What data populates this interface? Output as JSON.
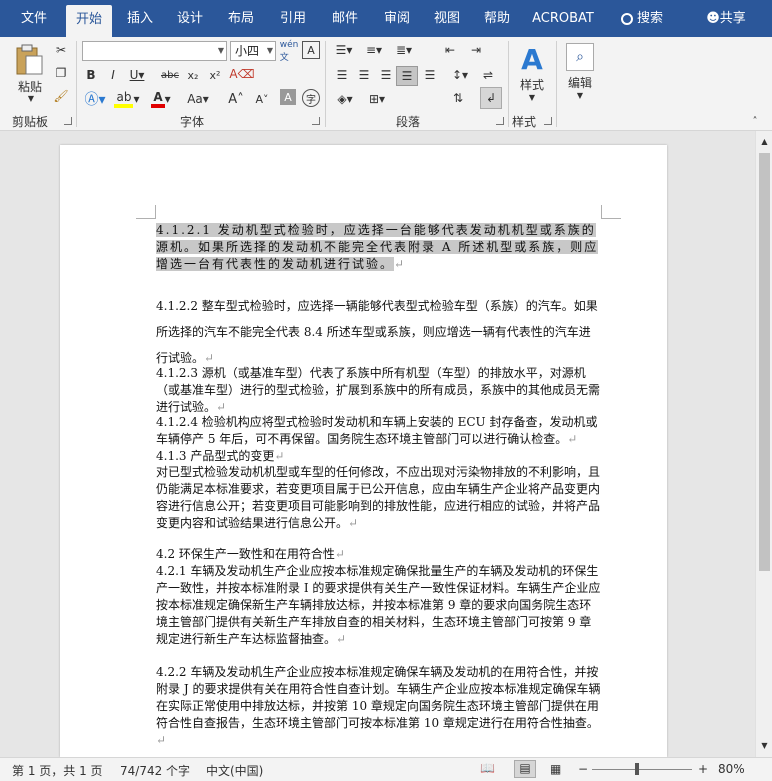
{
  "tabs": [
    {
      "label": "文件"
    },
    {
      "label": "开始"
    },
    {
      "label": "插入"
    },
    {
      "label": "设计"
    },
    {
      "label": "布局"
    },
    {
      "label": "引用"
    },
    {
      "label": "邮件"
    },
    {
      "label": "审阅"
    },
    {
      "label": "视图"
    },
    {
      "label": "帮助"
    },
    {
      "label": "ACROBAT"
    },
    {
      "label": "搜索"
    },
    {
      "label": "共享"
    }
  ],
  "ribbon": {
    "clipboard": {
      "paste_label": "粘贴",
      "group_label": "剪贴板"
    },
    "font": {
      "font_name": "",
      "font_size": "小四",
      "group_label": "字体"
    },
    "paragraph": {
      "group_label": "段落"
    },
    "styles": {
      "styles_label": "样式",
      "group_label": "样式"
    },
    "editing": {
      "edit_label": "编辑"
    }
  },
  "document": {
    "p1": "4.1.2.1 发动机型式检验时，应选择一台能够代表发动机机型或系族的源机。如果所选择的发动机不能完全代表附录 A 所述机型或系族，则应增选一台有代表性的发动机进行试验。",
    "p2": "4.1.2.2 整车型式检验时，应选择一辆能够代表型式检验车型（系族）的汽车。如果所选择的汽车不能完全代表 8.4 所述车型或系族，则应增选一辆有代表性的汽车进行试验。",
    "p3": "4.1.2.3 源机（或基准车型）代表了系族中所有机型（车型）的排放水平，对源机（或基准车型）进行的型式检验，扩展到系族中的所有成员，系族中的其他成员无需进行试验。",
    "p4": "4.1.2.4 检验机构应将型式检验时发动机和车辆上安装的 ECU 封存备查，发动机或车辆停产 5 年后，可不再保留。国务院生态环境主管部门可以进行确认检查。",
    "p5": "4.1.3 产品型式的变更",
    "p6": "对已型式检验发动机机型或车型的任何修改，不应出现对污染物排放的不利影响，且仍能满足本标准要求，若变更项目属于已公开信息，应由车辆生产企业将产品变更内容进行信息公开；若变更项目可能影响到的排放性能，应进行相应的试验，并将产品变更内容和试验结果进行信息公开。",
    "p7": "4.2 环保生产一致性和在用符合性",
    "p8": "4.2.1 车辆及发动机生产企业应按本标准规定确保批量生产的车辆及发动机的环保生产一致性，并按本标准附录 I 的要求提供有关生产一致性保证材料。车辆生产企业应按本标准规定确保新生产车辆排放达标，并按本标准第 9 章的要求向国务院生态环境主管部门提供有关新生产车排放自查的相关材料，生态环境主管部门可按第 9 章规定进行新生产车达标监督抽查。",
    "p9": "4.2.2 车辆及发动机生产企业应按本标准规定确保车辆及发动机的在用符合性，并按附录 J 的要求提供有关在用符合性自查计划。车辆生产企业应按本标准规定确保车辆在实际正常使用中排放达标，并按第 10 章规定向国务院生态环境主管部门提供在用符合性自查报告，生态环境主管部门可按本标准第 10 章规定进行在用符合性抽查。",
    "paragraph_mark": "↵"
  },
  "status": {
    "page": "第 1 页，共 1 页",
    "words": "74/742 个字",
    "language": "中文(中国)",
    "zoom": "80%"
  }
}
